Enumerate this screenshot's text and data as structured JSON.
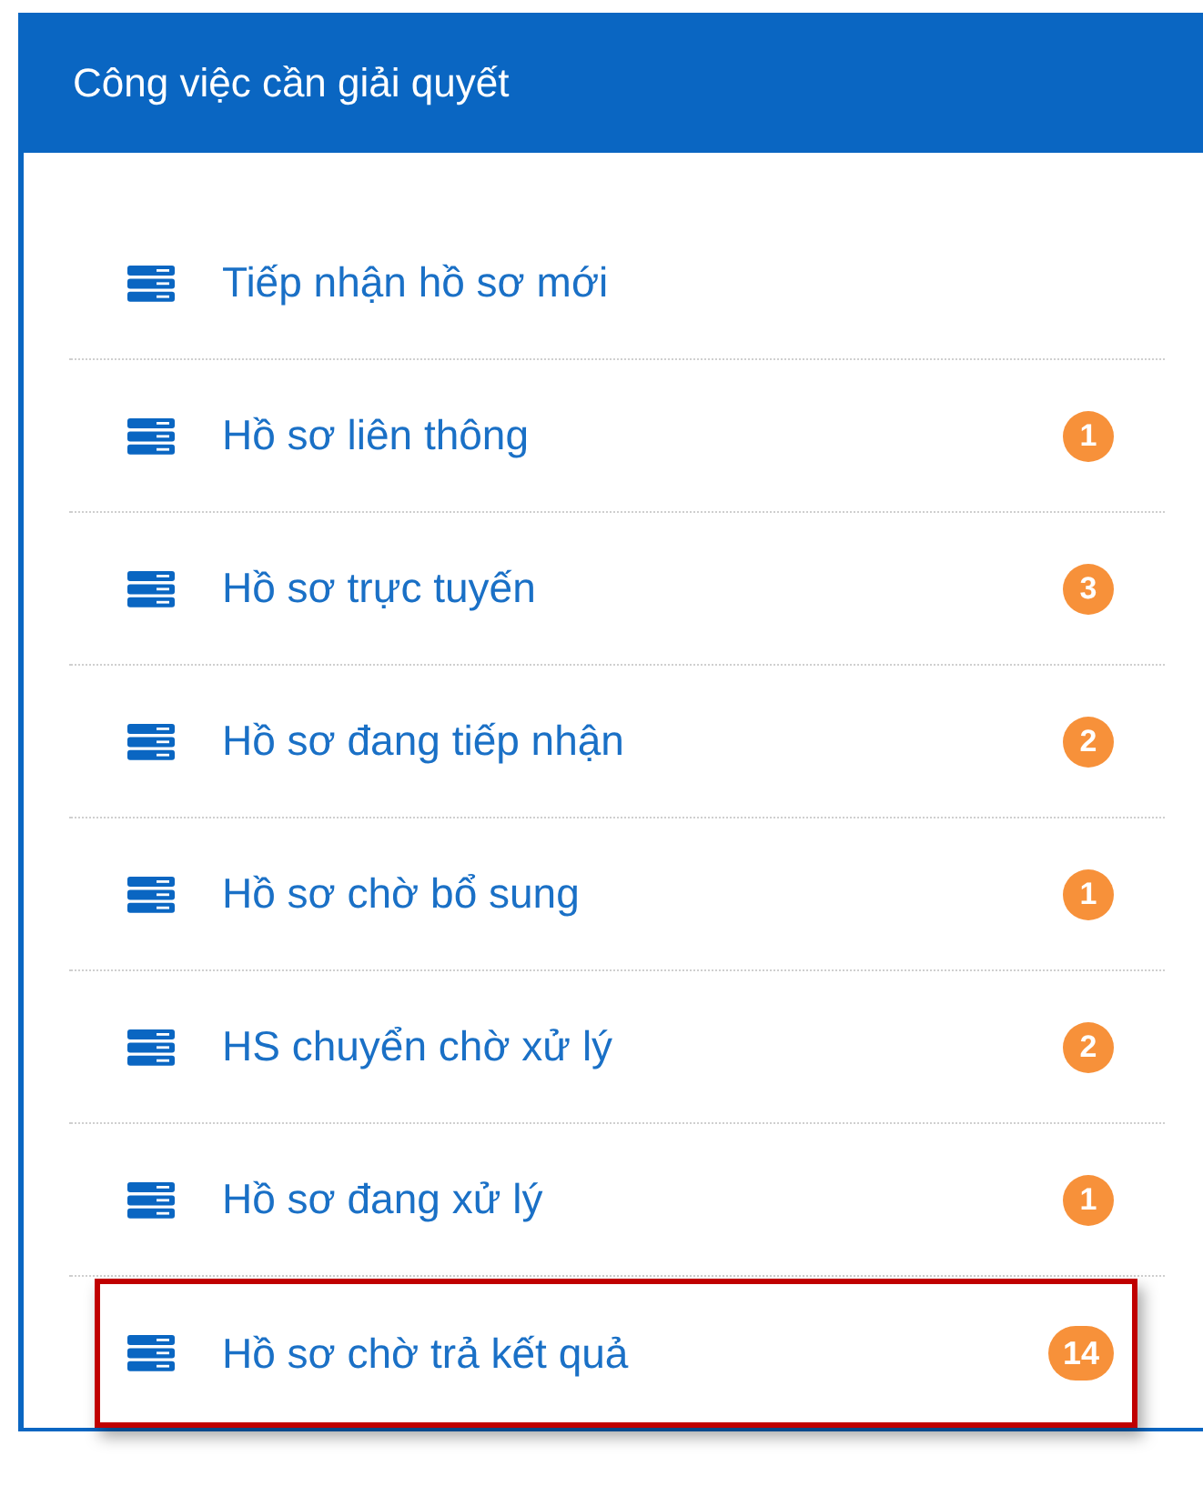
{
  "panel": {
    "title": "Công việc cần giải quyết"
  },
  "items": [
    {
      "label": "Tiếp nhận hồ sơ mới",
      "highlighted": false
    },
    {
      "label": "Hồ sơ liên thông",
      "count": "1",
      "highlighted": false
    },
    {
      "label": "Hồ sơ trực tuyến",
      "count": "3",
      "highlighted": false
    },
    {
      "label": "Hồ sơ đang tiếp nhận",
      "count": "2",
      "highlighted": false
    },
    {
      "label": "Hồ sơ chờ bổ sung",
      "count": "1",
      "highlighted": false
    },
    {
      "label": "HS chuyển chờ xử lý",
      "count": "2",
      "highlighted": false
    },
    {
      "label": "Hồ sơ đang xử lý",
      "count": "1",
      "highlighted": false
    },
    {
      "label": "Hồ sơ chờ trả kết quả",
      "count": "14",
      "highlighted": true
    }
  ]
}
